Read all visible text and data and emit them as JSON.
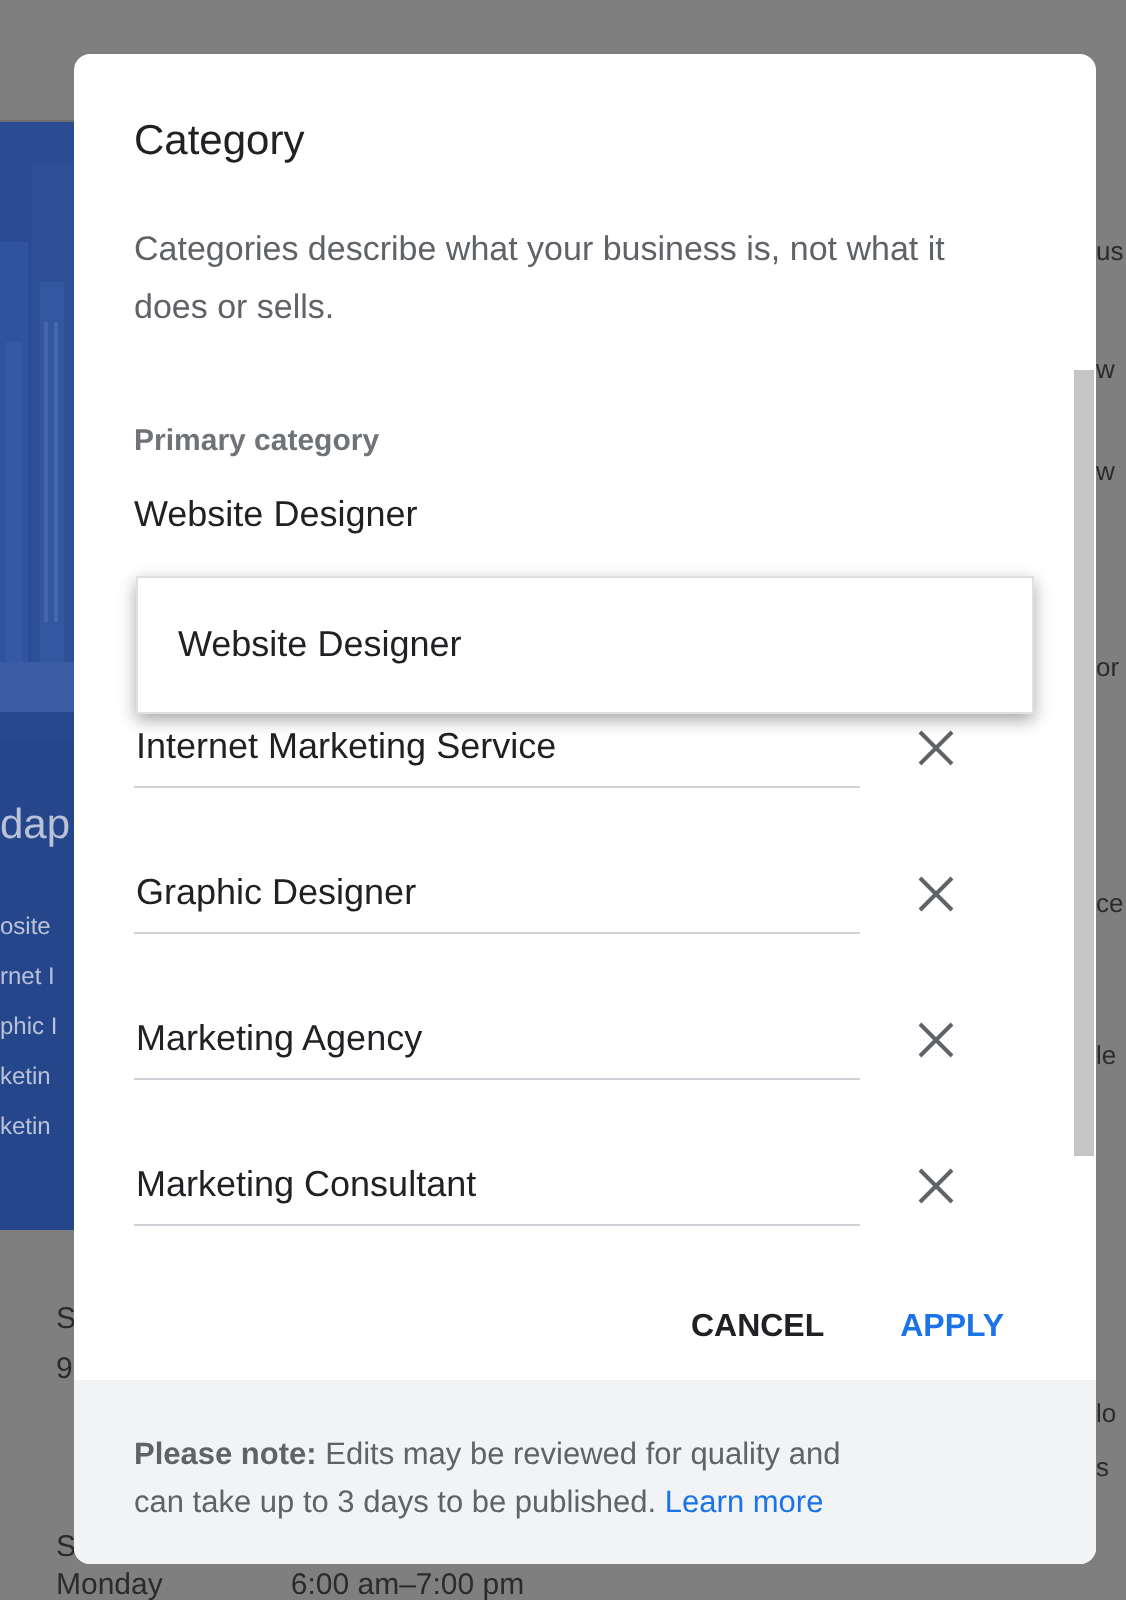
{
  "background_page": {
    "banner_heading": "dap",
    "banner_lines": [
      "osite",
      "rnet I",
      "phic I",
      "ketin",
      "ketin"
    ],
    "left_lines": [
      "S",
      "9",
      "S"
    ],
    "hours": {
      "day": "Monday",
      "time": "6:00 am–7:00 pm"
    },
    "right_fragments": [
      "us",
      "w",
      "w",
      "or",
      "ce",
      "le",
      "lo",
      "s"
    ]
  },
  "dialog": {
    "title": "Category",
    "description": "Categories describe what your business is, not what it does or sells.",
    "primary_label": "Primary category",
    "primary_value": "Website Designer",
    "suggestions": [
      "Website Designer"
    ],
    "additional_categories": [
      "Internet Marketing Service",
      "Graphic Designer",
      "Marketing Agency",
      "Marketing Consultant"
    ],
    "buttons": [
      {
        "label": "CANCEL",
        "kind": "text"
      },
      {
        "label": "APPLY",
        "kind": "primary"
      }
    ],
    "note": "**Please note:** Edits may be reviewed for quality and can take up to 3 days to be published.",
    "note_link": "Learn more"
  }
}
